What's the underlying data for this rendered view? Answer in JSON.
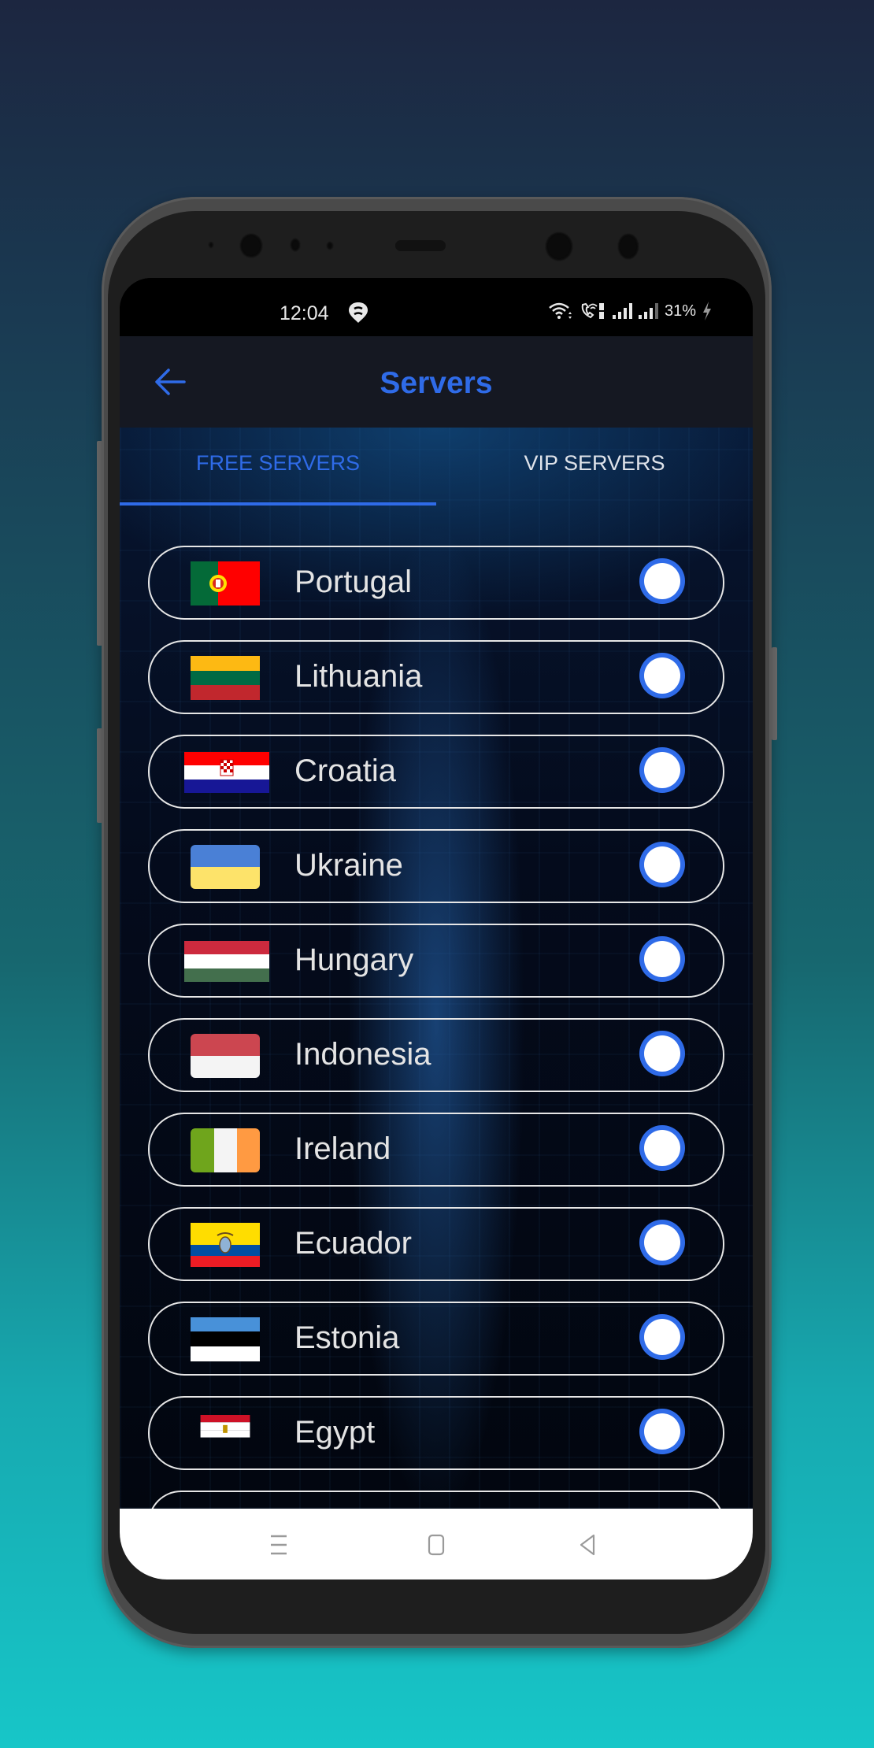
{
  "status_bar": {
    "time": "12:04",
    "notification_icon": "location-pin-s-icon",
    "battery": "31%",
    "icons": [
      "wifi-icon",
      "wifi-calling-icon",
      "signal-sim1-icon",
      "signal-sim2-icon",
      "battery-charging-icon"
    ]
  },
  "app_bar": {
    "title": "Servers",
    "back_icon": "arrow-left-icon"
  },
  "tabs": [
    {
      "label": "FREE SERVERS",
      "active": true
    },
    {
      "label": "VIP SERVERS",
      "active": false
    }
  ],
  "servers": [
    {
      "name": "Portugal",
      "flag": "portugal-flag",
      "selected": false
    },
    {
      "name": "Lithuania",
      "flag": "lithuania-flag",
      "selected": false
    },
    {
      "name": "Croatia",
      "flag": "croatia-flag",
      "selected": false
    },
    {
      "name": "Ukraine",
      "flag": "ukraine-flag",
      "selected": false
    },
    {
      "name": "Hungary",
      "flag": "hungary-flag",
      "selected": false
    },
    {
      "name": "Indonesia",
      "flag": "indonesia-flag",
      "selected": false
    },
    {
      "name": "Ireland",
      "flag": "ireland-flag",
      "selected": false
    },
    {
      "name": "Ecuador",
      "flag": "ecuador-flag",
      "selected": false
    },
    {
      "name": "Estonia",
      "flag": "estonia-flag",
      "selected": false
    },
    {
      "name": "Egypt",
      "flag": "egypt-flag",
      "selected": false
    }
  ],
  "nav_bar": [
    "recent-apps-icon",
    "home-icon",
    "back-icon"
  ],
  "colors": {
    "accent": "#2f6be8",
    "appbar_bg": "#151822",
    "text_light": "#e4e4e4"
  }
}
